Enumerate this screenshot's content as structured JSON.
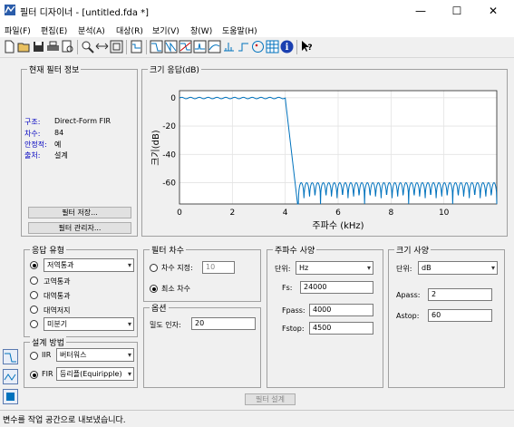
{
  "window": {
    "title": "필터 디자이너 - [untitled.fda *]",
    "minimize_symbol": "—",
    "maximize_symbol": "☐",
    "close_symbol": "✕"
  },
  "menu": [
    "파일(F)",
    "편집(E)",
    "분석(A)",
    "대상(R)",
    "보기(V)",
    "창(W)",
    "도움말(H)"
  ],
  "toolbar_icons": [
    "new-icon",
    "open-icon",
    "save-icon",
    "print-icon",
    "print-preview-icon",
    "zoom-in-icon",
    "zoom-x-icon",
    "full-view-icon",
    "filter-specs-icon",
    "magnitude-response-icon",
    "phase-response-icon",
    "mag-phase-icon",
    "group-delay-icon",
    "phase-delay-icon",
    "impulse-response-icon",
    "step-response-icon",
    "pole-zero-icon",
    "coefficients-icon",
    "filter-info-icon",
    "whats-this-icon"
  ],
  "current_filter": {
    "title": "현재 필터 정보",
    "rows": [
      {
        "label": "구조:",
        "value": "Direct-Form FIR"
      },
      {
        "label": "차수:",
        "value": "84"
      },
      {
        "label": "안정적:",
        "value": "예"
      },
      {
        "label": "출처:",
        "value": "설계"
      }
    ],
    "store_button": "필터 저장...",
    "manager_button": "필터 관리자..."
  },
  "plot": {
    "title": "크기 응답(dB)"
  },
  "chart_data": {
    "type": "line",
    "title": "",
    "xlabel": "주파수 (kHz)",
    "ylabel": "크기(dB)",
    "xlim": [
      0,
      12
    ],
    "ylim": [
      -75,
      5
    ],
    "xticks": [
      0,
      2,
      4,
      6,
      8,
      10
    ],
    "yticks": [
      0,
      -20,
      -40,
      -60
    ],
    "grid": true,
    "series": [
      {
        "color": "#0072bd",
        "passband_edge_khz": 4.0,
        "stopband_edge_khz": 4.5,
        "passband_ripple_db": 1,
        "stopband_peak_db": -60,
        "stopband_min_db": -75,
        "passband_ripple_count": 12,
        "stopband_lobe_count": 36
      }
    ]
  },
  "response_type": {
    "title": "응답 유형",
    "options": [
      {
        "label": "저역통과",
        "selected": true,
        "dropdown": true
      },
      {
        "label": "고역통과",
        "selected": false
      },
      {
        "label": "대역통과",
        "selected": false
      },
      {
        "label": "대역저지",
        "selected": false
      },
      {
        "label": "미분기",
        "selected": false,
        "dropdown": true
      }
    ]
  },
  "design_method": {
    "title": "설계 방법",
    "iir_label": "IIR",
    "iir_value": "버터워스",
    "fir_label": "FIR",
    "fir_value": "등리플(Equiripple)",
    "selected": "FIR"
  },
  "filter_order": {
    "title": "필터 차수",
    "specify_label": "차수 지정:",
    "specify_value": "10",
    "minimum_label": "최소 차수"
  },
  "options": {
    "title": "옵션",
    "density_label": "밀도 인자:",
    "density_value": "20"
  },
  "freq_specs": {
    "title": "주파수 사양",
    "units_label": "단위:",
    "units_value": "Hz",
    "fs_label": "Fs:",
    "fs_value": "24000",
    "fpass_label": "Fpass:",
    "fpass_value": "4000",
    "fstop_label": "Fstop:",
    "fstop_value": "4500"
  },
  "mag_specs": {
    "title": "크기 사양",
    "units_label": "단위:",
    "units_value": "dB",
    "apass_label": "Apass:",
    "apass_value": "2",
    "astop_label": "Astop:",
    "astop_value": "60"
  },
  "design_button": "필터 설계",
  "status": "변수를 작업 공간으로 내보냈습니다."
}
